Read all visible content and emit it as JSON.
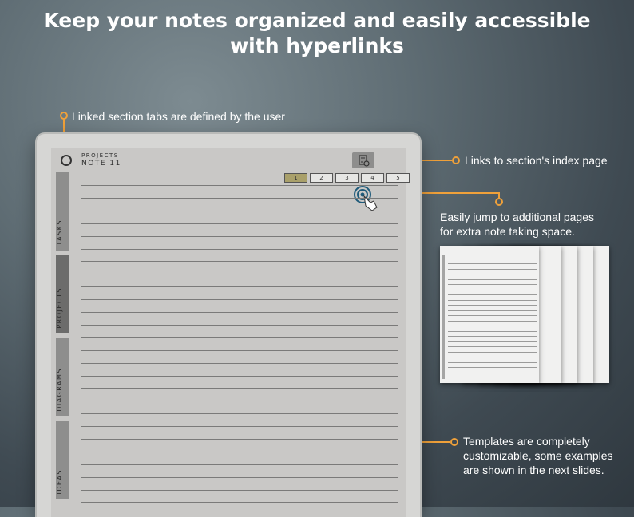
{
  "headline": {
    "line1": "Keep your notes organized and easily accessible",
    "line2": "with hyperlinks"
  },
  "callouts": {
    "tabs": "Linked section tabs are defined by the user",
    "index": "Links to section's index page",
    "jump_line1": "Easily jump to additional pages",
    "jump_line2": "for extra note taking space.",
    "templates_line1": "Templates are completely",
    "templates_line2": "customizable, some examples",
    "templates_line3": "are shown in the next slides."
  },
  "planner": {
    "section_title": "PROJECTS",
    "note_title": "NOTE 11",
    "tabs": [
      "TASKS",
      "PROJECTS",
      "DIAGRAMS",
      "IDEAS"
    ],
    "active_tab": "PROJECTS",
    "pages": [
      "1",
      "2",
      "3",
      "4",
      "5"
    ],
    "active_page": "1",
    "icons": {
      "section-toggle": "circle-icon",
      "index": "document-index-icon",
      "tap": "tap-gesture-icon"
    }
  },
  "colors": {
    "accent": "#f0a13a",
    "active_page": "#a9a06a",
    "device": "#d6d6d4"
  }
}
